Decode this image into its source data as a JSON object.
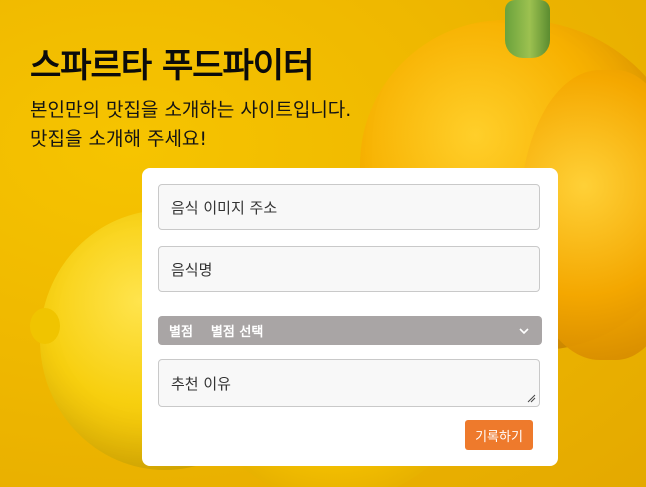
{
  "header": {
    "title": "스파르타 푸드파이터",
    "description_line1": "본인만의 맛집을 소개하는 사이트입니다.",
    "description_line2": "맛집을 소개해 주세요!"
  },
  "form": {
    "image_url_placeholder": "음식 이미지 주소",
    "food_name_placeholder": "음식명",
    "rating_label": "별점",
    "rating_selected": "별점 선택",
    "reason_placeholder": "추천 이유",
    "submit_label": "기록하기"
  },
  "colors": {
    "accent": "#ee7a2c",
    "select_bg": "#a9a5a5",
    "hero_bg": "#efb800"
  }
}
